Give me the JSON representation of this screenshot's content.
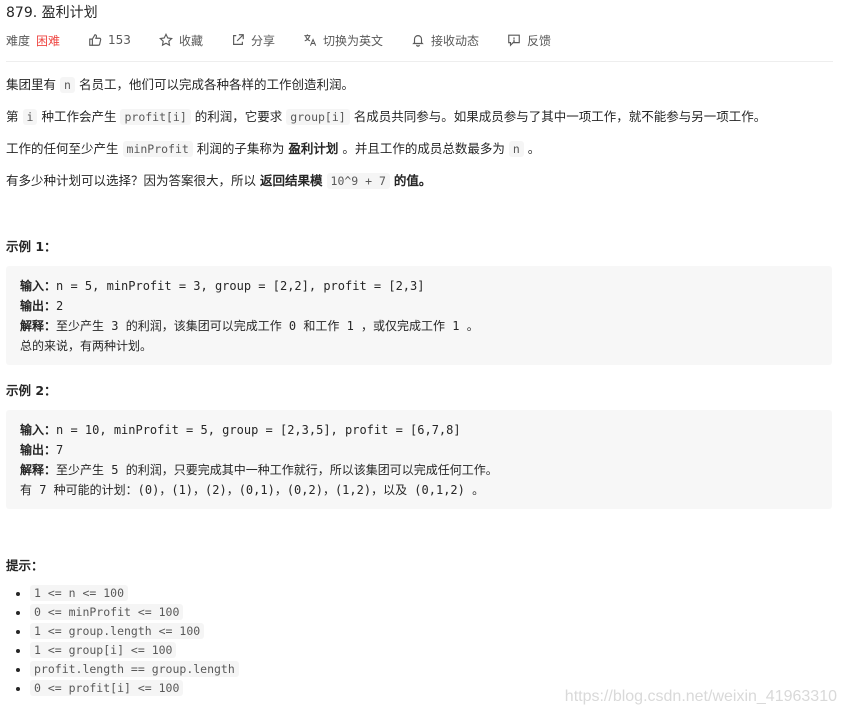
{
  "problem": {
    "title": "879. 盈利计划",
    "difficulty_label": "难度",
    "difficulty": "困难",
    "likes": "153",
    "favorite": "收藏",
    "share": "分享",
    "translate": "切换为英文",
    "subscribe": "接收动态",
    "feedback": "反馈"
  },
  "description": {
    "p1_a": "集团里有",
    "p1_code": "n",
    "p1_b": "名员工，他们可以完成各种各样的工作创造利润。",
    "p2_a": "第",
    "p2_code1": "i",
    "p2_b": "种工作会产生",
    "p2_code2": "profit[i]",
    "p2_c": "的利润，它要求",
    "p2_code3": "group[i]",
    "p2_d": "名成员共同参与。如果成员参与了其中一项工作，就不能参与另一项工作。",
    "p3_a": "工作的任何至少产生",
    "p3_code1": "minProfit",
    "p3_b": "利润的子集称为",
    "p3_bold": "盈利计划",
    "p3_c": "。并且工作的成员总数最多为",
    "p3_code2": "n",
    "p3_d": "。",
    "p4_a": "有多少种计划可以选择？因为答案很大，所以",
    "p4_bold1": "返回结果模",
    "p4_code": "10^9 + 7",
    "p4_bold2": "的值。"
  },
  "examples": [
    {
      "heading": "示例 1：",
      "input_label": "输入：",
      "input": "n = 5, minProfit = 3, group = [2,2], profit = [2,3]",
      "output_label": "输出：",
      "output": "2",
      "explain_label": "解释：",
      "explain": "至少产生 3 的利润，该集团可以完成工作 0 和工作 1 ，或仅完成工作 1 。",
      "extra": "总的来说，有两种计划。"
    },
    {
      "heading": "示例 2：",
      "input_label": "输入：",
      "input": "n = 10, minProfit = 5, group = [2,3,5], profit = [6,7,8]",
      "output_label": "输出：",
      "output": "7",
      "explain_label": "解释：",
      "explain": "至少产生 5 的利润，只要完成其中一种工作就行，所以该集团可以完成任何工作。",
      "extra": "有 7 种可能的计划：(0)，(1)，(2)，(0,1)，(0,2)，(1,2)，以及 (0,1,2) 。"
    }
  ],
  "hints": {
    "heading": "提示：",
    "items": [
      "1 <= n <= 100",
      "0 <= minProfit <= 100",
      "1 <= group.length <= 100",
      "1 <= group[i] <= 100",
      "profit.length == group.length",
      "0 <= profit[i] <= 100"
    ]
  },
  "watermark": "https://blog.csdn.net/weixin_41963310"
}
